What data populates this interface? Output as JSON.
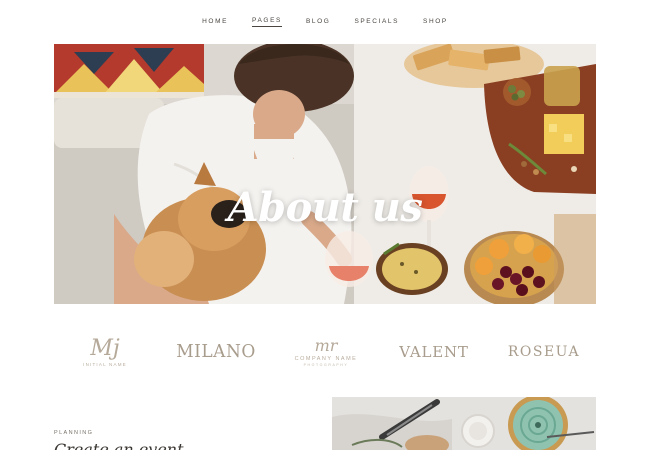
{
  "nav": {
    "items": [
      {
        "label": "HOME",
        "active": false
      },
      {
        "label": "PAGES",
        "active": true
      },
      {
        "label": "BLOG",
        "active": false
      },
      {
        "label": "SPECIALS",
        "active": false
      },
      {
        "label": "SHOP",
        "active": false
      }
    ]
  },
  "hero": {
    "title": "About us"
  },
  "logos": {
    "logo1": {
      "mark": "Mj",
      "sub": "INITIAL NAME"
    },
    "logo2": {
      "word": "MILANO"
    },
    "logo3": {
      "mark": "mr",
      "sub": "COMPANY NAME",
      "sub2": "PHOTOGRAPHY"
    },
    "logo4": {
      "word": "VALENT"
    },
    "logo5": {
      "word": "ROSEUA"
    }
  },
  "section": {
    "label": "PLANNING",
    "title": "Create an event"
  },
  "colors": {
    "accent_text": "#4a4540",
    "logo_tone": "#b5a999",
    "background": "#ffffff"
  }
}
